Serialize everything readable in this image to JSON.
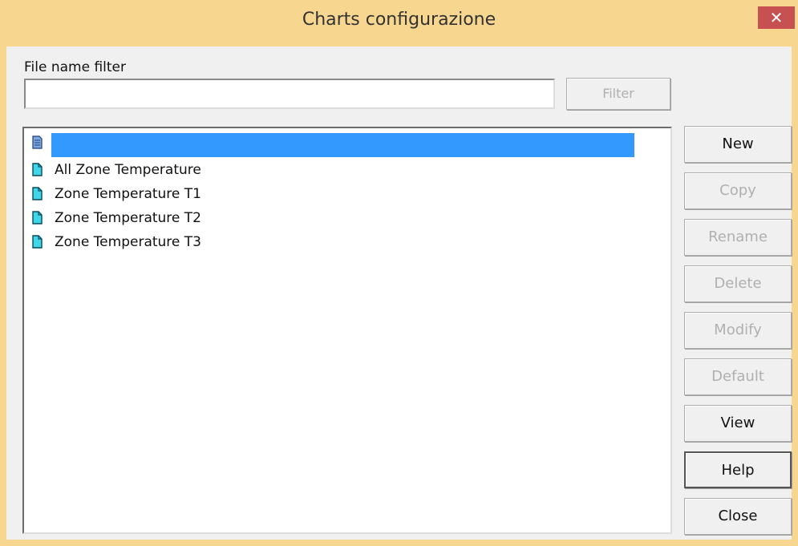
{
  "window": {
    "title": "Charts configurazione",
    "close_glyph": "✕"
  },
  "filter": {
    "label": "File name filter",
    "value": "",
    "placeholder": "",
    "button_label": "Filter"
  },
  "list": {
    "items": [
      {
        "label": "",
        "selected": true,
        "icon": "chart-doc-icon"
      },
      {
        "label": "All Zone Temperature",
        "selected": false,
        "icon": "doc-icon"
      },
      {
        "label": "Zone Temperature T1",
        "selected": false,
        "icon": "doc-icon"
      },
      {
        "label": "Zone Temperature T2",
        "selected": false,
        "icon": "doc-icon"
      },
      {
        "label": "Zone Temperature T3",
        "selected": false,
        "icon": "doc-icon"
      }
    ]
  },
  "buttons": {
    "new": "New",
    "copy": "Copy",
    "rename": "Rename",
    "delete": "Delete",
    "modify": "Modify",
    "default": "Default",
    "view": "View",
    "help": "Help",
    "close": "Close"
  },
  "colors": {
    "title_bar": "#f7d690",
    "close_button": "#c75050",
    "selection": "#3399ff",
    "doc_icon": "#00bcd4"
  }
}
